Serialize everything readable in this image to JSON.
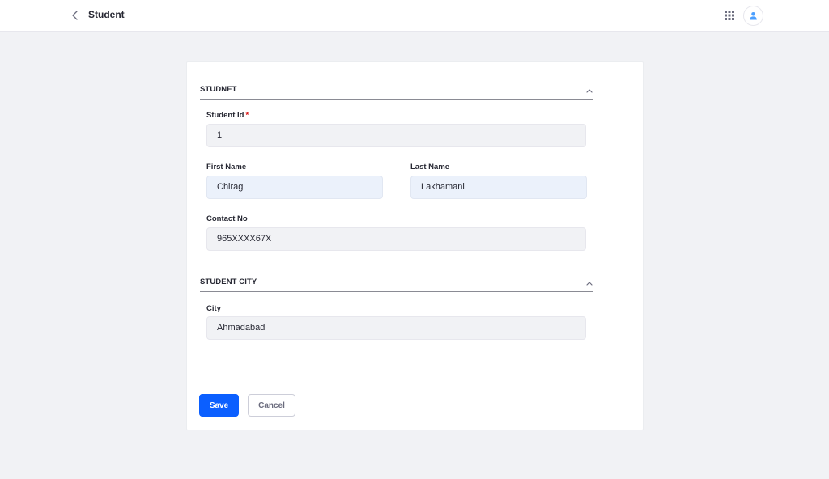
{
  "header": {
    "title": "Student",
    "back_icon": "chevron-left-icon",
    "apps_icon": "apps-grid-icon",
    "user_icon": "user-icon"
  },
  "sections": [
    {
      "title": "STUDNET",
      "fields": [
        {
          "label": "Student Id",
          "required_mark": "*",
          "value": "1"
        },
        {
          "label": "First Name",
          "value": "Chirag"
        },
        {
          "label": "Last Name",
          "value": "Lakhamani"
        },
        {
          "label": "Contact No",
          "value": "965XXXX67X"
        }
      ]
    },
    {
      "title": "STUDENT CITY",
      "fields": [
        {
          "label": "City",
          "value": "Ahmadabad"
        }
      ]
    }
  ],
  "actions": {
    "save_label": "Save",
    "cancel_label": "Cancel"
  },
  "colors": {
    "primary": "#0b5fff",
    "required": "#da1414",
    "background": "#f1f2f5"
  }
}
